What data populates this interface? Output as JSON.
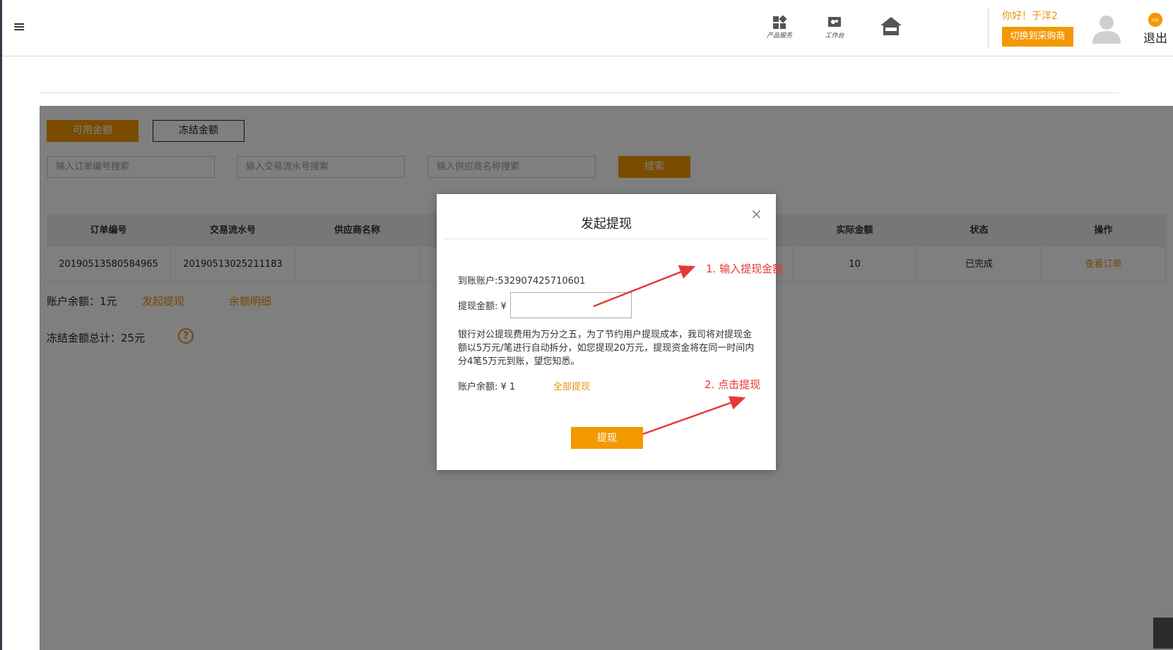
{
  "header": {
    "nav": [
      {
        "label": "产品服务",
        "icon": "grid-icon"
      },
      {
        "label": "工作台",
        "icon": "workbench-icon"
      },
      {
        "label": "",
        "icon": "home-icon"
      }
    ],
    "greeting": "你好！于洋2",
    "switch_label": "切换到采购商",
    "logout_label": "退出"
  },
  "main": {
    "tabs": {
      "available": "可用金额",
      "frozen": "冻结金额"
    },
    "search": {
      "order_placeholder": "输入订单编号搜索",
      "serial_placeholder": "输入交易流水号搜索",
      "supplier_placeholder": "输入供应商名称搜索",
      "button": "搜索"
    },
    "table": {
      "headers": [
        "订单编号",
        "交易流水号",
        "供应商名称",
        "",
        "",
        "",
        "实际金额",
        "状态",
        "操作"
      ],
      "rows": [
        [
          "20190513580584965",
          "20190513025211183",
          "",
          "",
          "",
          "",
          "10",
          "已完成",
          "查看订单"
        ]
      ]
    },
    "balance_text": "账户余额：1元",
    "withdraw_link": "发起提现",
    "detail_link": "余额明细",
    "frozen_total": "冻结金额总计：25元"
  },
  "modal": {
    "title": "发起提现",
    "account": "到账账户:532907425710601",
    "amount_label": "提现金额: ¥",
    "amount_value": "",
    "notice": "银行对公提现费用为万分之五，为了节约用户提现成本，我司将对提现金额以5万元/笔进行自动拆分，如您提现20万元，提现资金将在同一时间内分4笔5万元到账，望您知悉。",
    "balance": "账户余额: ¥ 1",
    "withdraw_all": "全部提现",
    "submit": "提现"
  },
  "annotations": {
    "step1": "1. 输入提现金额",
    "step2": "2. 点击提现"
  },
  "colors": {
    "accent": "#f39800",
    "annotation": "#e53935"
  }
}
